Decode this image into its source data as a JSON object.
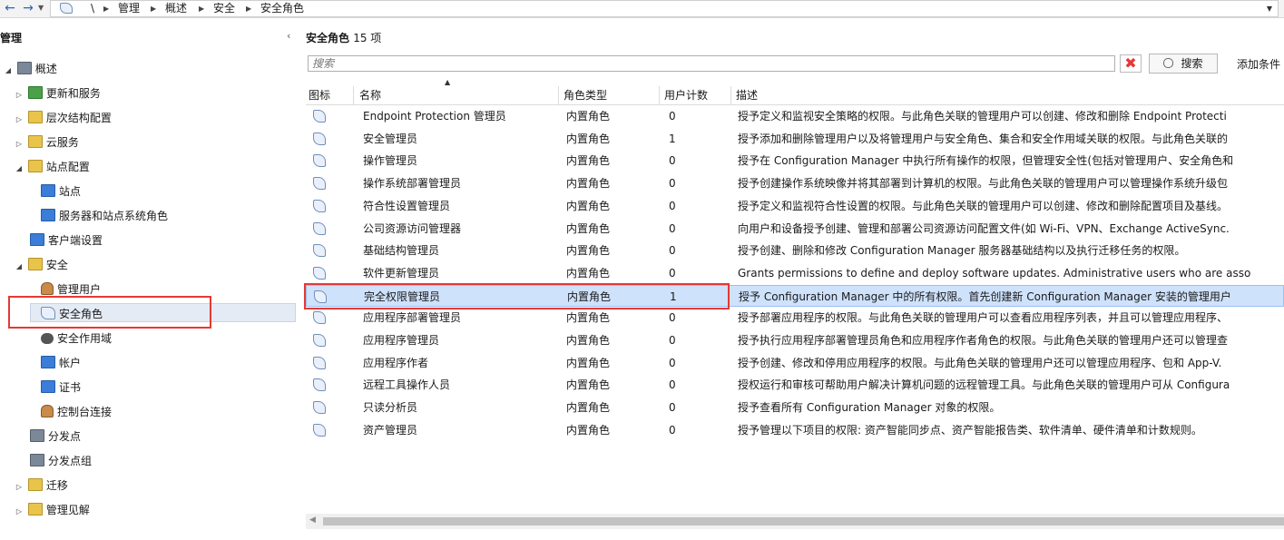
{
  "addressbar": {
    "back_icon": "←",
    "forward_icon": "→",
    "root_sep": "\\",
    "breadcrumbs": [
      "管理",
      "概述",
      "安全",
      "安全角色"
    ]
  },
  "nav": {
    "title": "管理",
    "collapse": "‹",
    "items": [
      {
        "label": "概述"
      },
      {
        "label": "更新和服务"
      },
      {
        "label": "层次结构配置"
      },
      {
        "label": "云服务"
      },
      {
        "label": "站点配置"
      },
      {
        "label": "站点"
      },
      {
        "label": "服务器和站点系统角色"
      },
      {
        "label": "客户端设置"
      },
      {
        "label": "安全"
      },
      {
        "label": "管理用户"
      },
      {
        "label": "安全角色"
      },
      {
        "label": "安全作用域"
      },
      {
        "label": "帐户"
      },
      {
        "label": "证书"
      },
      {
        "label": "控制台连接"
      },
      {
        "label": "分发点"
      },
      {
        "label": "分发点组"
      },
      {
        "label": "迁移"
      },
      {
        "label": "管理见解"
      }
    ]
  },
  "main": {
    "title": "安全角色",
    "count": "15 项",
    "search_placeholder": "搜索",
    "clear_icon": "✖",
    "search_button": "搜索",
    "add_criteria": "添加条件",
    "columns": [
      "图标",
      "名称",
      "角色类型",
      "用户计数",
      "描述"
    ],
    "rows": [
      {
        "name": "Endpoint Protection 管理员",
        "type": "内置角色",
        "count": "0",
        "desc": "授予定义和监视安全策略的权限。与此角色关联的管理用户可以创建、修改和删除 Endpoint Protecti"
      },
      {
        "name": "安全管理员",
        "type": "内置角色",
        "count": "1",
        "desc": "授予添加和删除管理用户以及将管理用户与安全角色、集合和安全作用域关联的权限。与此角色关联的"
      },
      {
        "name": "操作管理员",
        "type": "内置角色",
        "count": "0",
        "desc": "授予在 Configuration Manager 中执行所有操作的权限，但管理安全性(包括对管理用户、安全角色和"
      },
      {
        "name": "操作系统部署管理员",
        "type": "内置角色",
        "count": "0",
        "desc": "授予创建操作系统映像并将其部署到计算机的权限。与此角色关联的管理用户可以管理操作系统升级包"
      },
      {
        "name": "符合性设置管理员",
        "type": "内置角色",
        "count": "0",
        "desc": "授予定义和监视符合性设置的权限。与此角色关联的管理用户可以创建、修改和删除配置项目及基线。"
      },
      {
        "name": "公司资源访问管理器",
        "type": "内置角色",
        "count": "0",
        "desc": "向用户和设备授予创建、管理和部署公司资源访问配置文件(如 Wi-Fi、VPN、Exchange ActiveSync."
      },
      {
        "name": "基础结构管理员",
        "type": "内置角色",
        "count": "0",
        "desc": "授予创建、删除和修改 Configuration Manager 服务器基础结构以及执行迁移任务的权限。"
      },
      {
        "name": "软件更新管理员",
        "type": "内置角色",
        "count": "0",
        "desc": "Grants permissions to define and deploy software updates. Administrative users who are asso"
      },
      {
        "name": "完全权限管理员",
        "type": "内置角色",
        "count": "1",
        "desc": "授予 Configuration Manager 中的所有权限。首先创建新 Configuration Manager 安装的管理用户"
      },
      {
        "name": "应用程序部署管理员",
        "type": "内置角色",
        "count": "0",
        "desc": "授予部署应用程序的权限。与此角色关联的管理用户可以查看应用程序列表，并且可以管理应用程序、"
      },
      {
        "name": "应用程序管理员",
        "type": "内置角色",
        "count": "0",
        "desc": "授予执行应用程序部署管理员角色和应用程序作者角色的权限。与此角色关联的管理用户还可以管理查"
      },
      {
        "name": "应用程序作者",
        "type": "内置角色",
        "count": "0",
        "desc": "授予创建、修改和停用应用程序的权限。与此角色关联的管理用户还可以管理应用程序、包和 App-V."
      },
      {
        "name": "远程工具操作人员",
        "type": "内置角色",
        "count": "0",
        "desc": "授权运行和审核可帮助用户解决计算机问题的远程管理工具。与此角色关联的管理用户可从 Configura"
      },
      {
        "name": "只读分析员",
        "type": "内置角色",
        "count": "0",
        "desc": "授予查看所有 Configuration Manager 对象的权限。"
      },
      {
        "name": "资产管理员",
        "type": "内置角色",
        "count": "0",
        "desc": "授予管理以下项目的权限: 资产智能同步点、资产智能报告类、软件清单、硬件清单和计数规则。"
      }
    ]
  },
  "colors": {
    "highlight_border": "#e53935",
    "selected_row": "#cfe2fb"
  }
}
